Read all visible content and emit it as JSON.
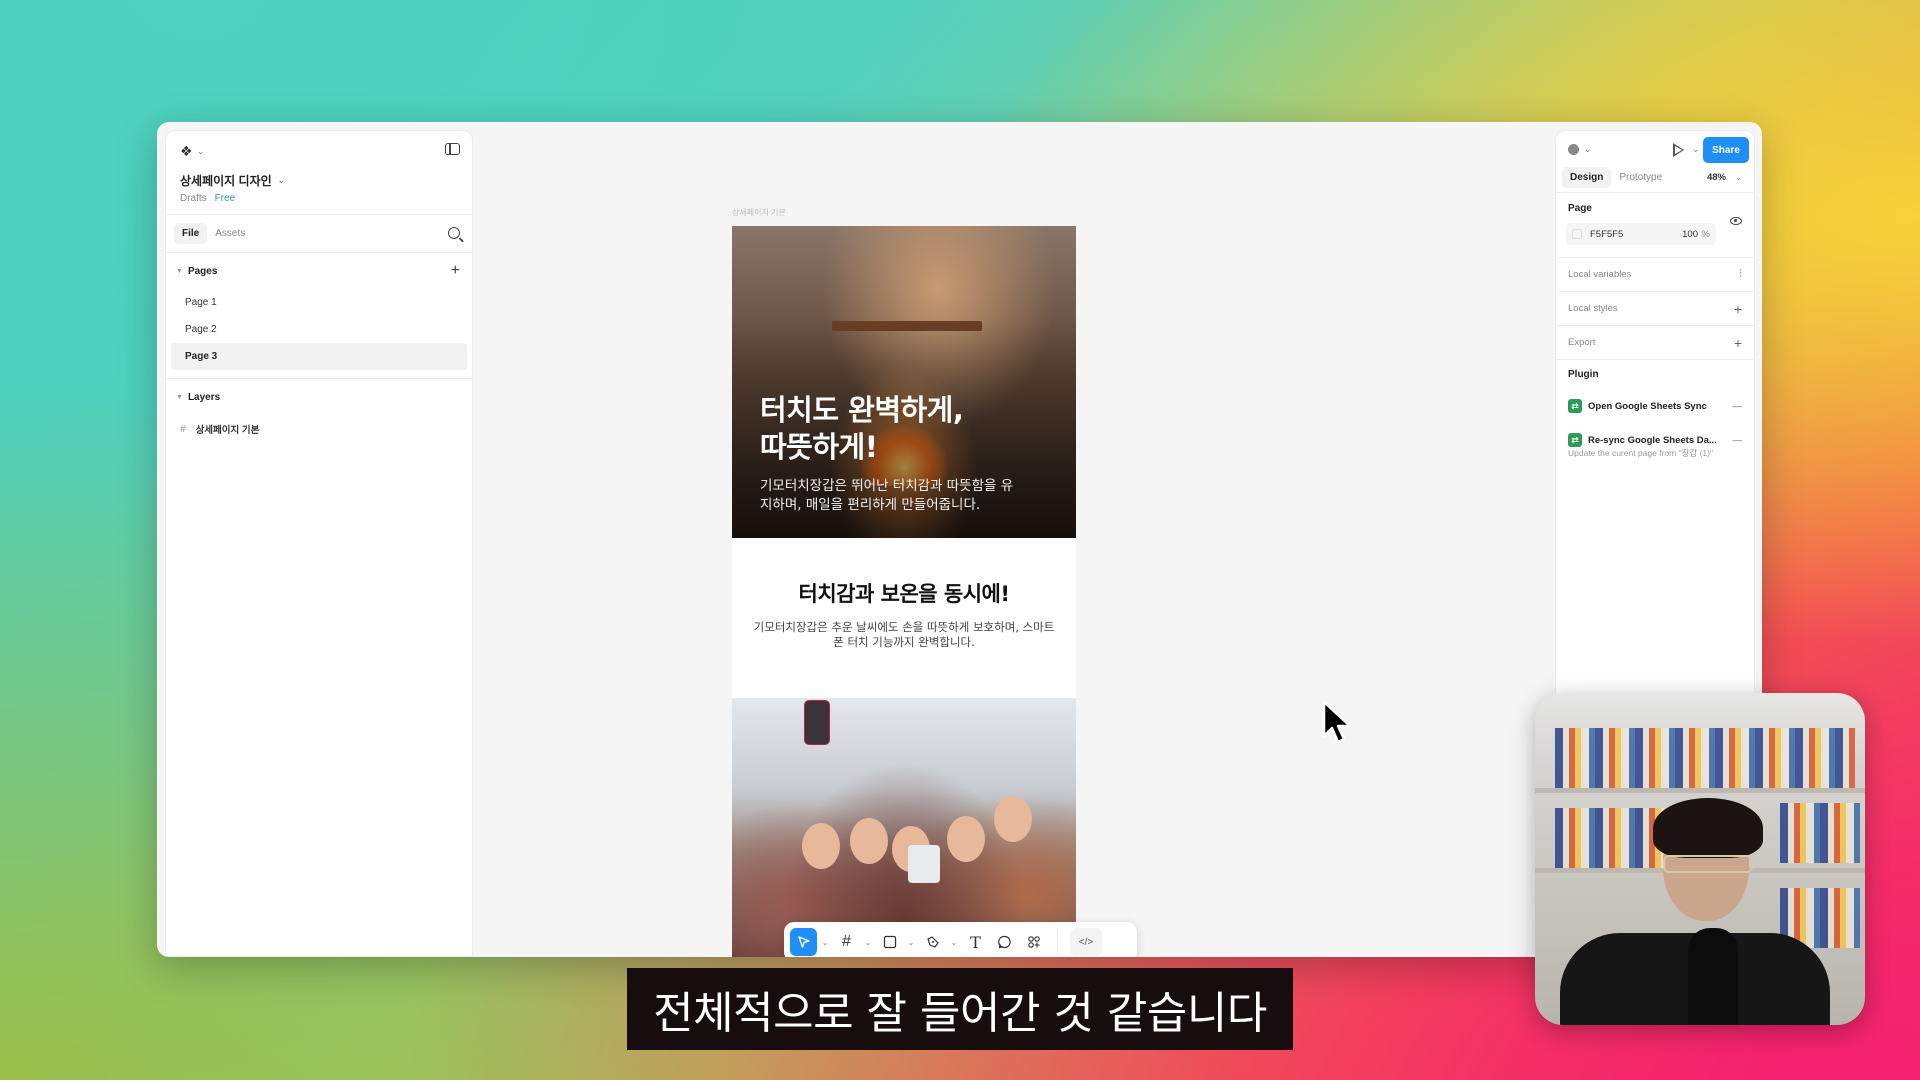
{
  "app": {
    "file_title": "상세페이지 디자인",
    "location": "Drafts",
    "plan": "Free"
  },
  "left_panel": {
    "tabs": [
      {
        "label": "File",
        "active": true
      },
      {
        "label": "Assets",
        "active": false
      }
    ],
    "pages_header": "Pages",
    "pages": [
      {
        "label": "Page 1",
        "selected": false
      },
      {
        "label": "Page 2",
        "selected": false
      },
      {
        "label": "Page 3",
        "selected": true
      }
    ],
    "layers_header": "Layers",
    "layers": [
      {
        "label": "상세페이지 기본",
        "icon": "frame-icon"
      }
    ]
  },
  "canvas": {
    "frame_label": "상세페이지 기본",
    "hero_title_line1": "터치도 완벽하게,",
    "hero_title_line2": "따뜻하게!",
    "hero_desc_line1": "기모터치장갑은 뛰어난 터치감과 따뜻함을 유",
    "hero_desc_line2": "지하며, 매일을 편리하게 만들어줍니다.",
    "section2_title": "터치감과 보온을 동시에!",
    "section2_desc_line1": "기모터치장갑은 추운 날씨에도 손을 따뜻하게 보호하며, 스마트",
    "section2_desc_line2": "폰 터치 기능까지 완벽합니다."
  },
  "toolbar": {
    "tools": [
      {
        "name": "move",
        "icon": "cursor-arrow-icon",
        "active": true,
        "has_dropdown": true
      },
      {
        "name": "frame",
        "icon": "frame-hash-icon",
        "active": false,
        "has_dropdown": true
      },
      {
        "name": "shape",
        "icon": "rectangle-icon",
        "active": false,
        "has_dropdown": true
      },
      {
        "name": "pen",
        "icon": "pen-icon",
        "active": false,
        "has_dropdown": true
      },
      {
        "name": "text",
        "icon": "text-icon",
        "active": false,
        "has_dropdown": false
      },
      {
        "name": "comment",
        "icon": "comment-icon",
        "active": false,
        "has_dropdown": false
      },
      {
        "name": "actions",
        "icon": "actions-icon",
        "active": false,
        "has_dropdown": false
      }
    ],
    "dev_mode_label": "</>"
  },
  "right_panel": {
    "share_label": "Share",
    "tabs": [
      {
        "label": "Design",
        "active": true
      },
      {
        "label": "Prototype",
        "active": false
      }
    ],
    "zoom": "48%",
    "page_section": "Page",
    "page_color": "F5F5F5",
    "page_opacity": "100",
    "opacity_unit": "%",
    "rows": [
      {
        "label": "Local variables",
        "icon": "variables-icon"
      },
      {
        "label": "Local styles",
        "icon": "plus-icon"
      },
      {
        "label": "Export",
        "icon": "plus-icon"
      }
    ],
    "plugin_section": "Plugin",
    "plugins": [
      {
        "label": "Open Google Sheets Sync"
      },
      {
        "label": "Re-sync Google Sheets Da..."
      }
    ],
    "plugin_note": "Update the curent page from \"장갑 (1)\""
  },
  "subtitle": "전체적으로 잘 들어간 것 같습니다",
  "colors": {
    "accent": "#1e90f5",
    "plugin_green": "#2d9c5a",
    "canvas_bg": "#f5f5f5"
  }
}
